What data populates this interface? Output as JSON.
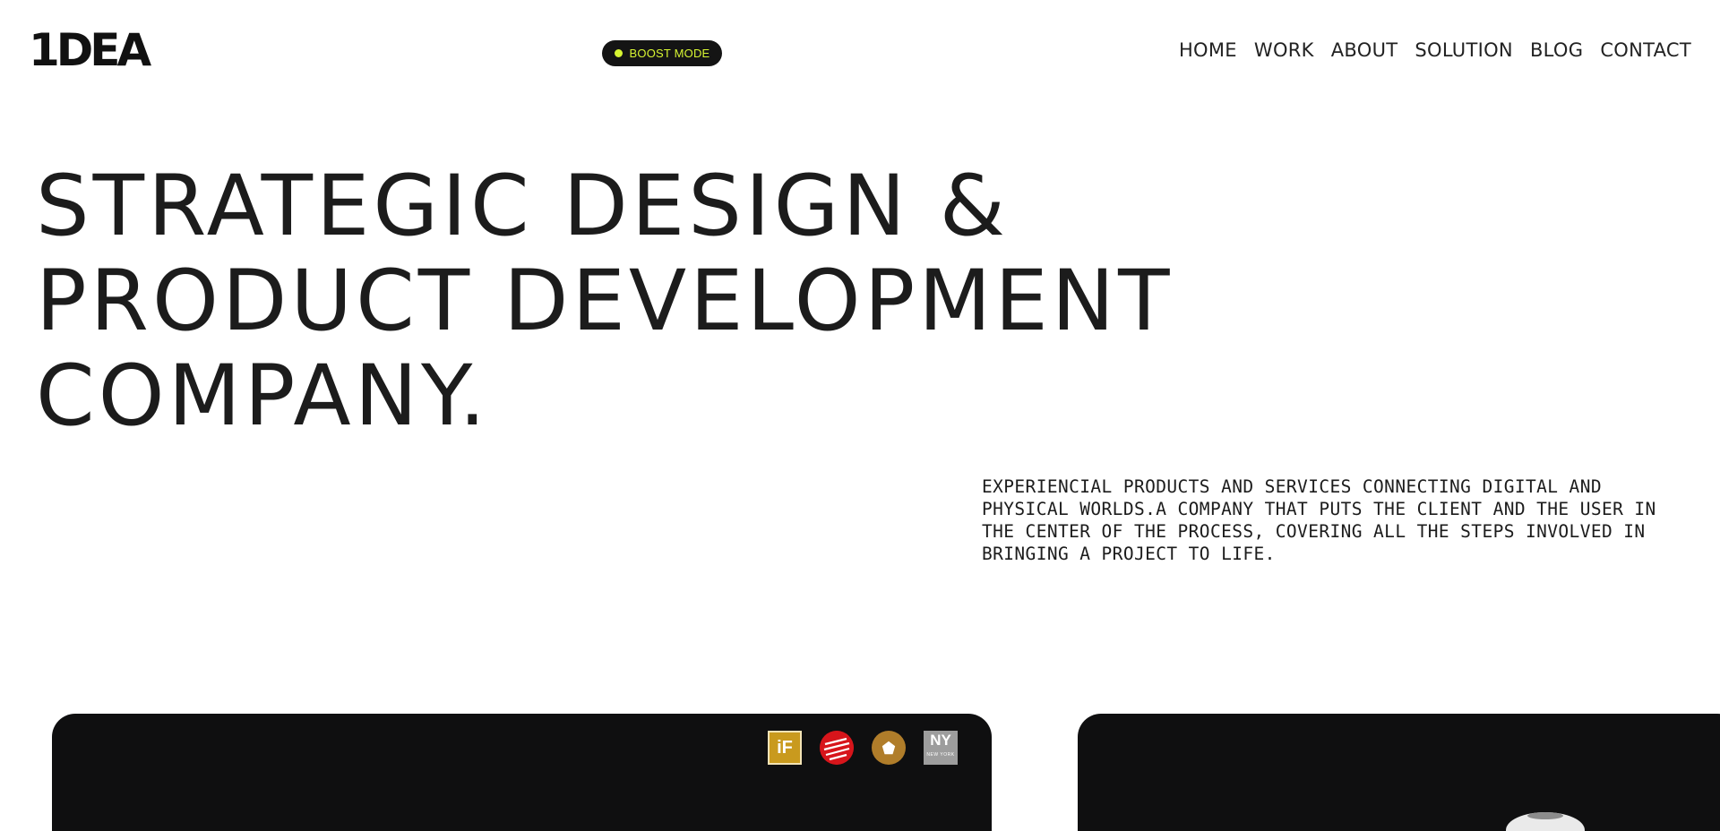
{
  "header": {
    "logo": "1DEA",
    "boost_mode_label": "BOOST MODE",
    "nav": [
      "HOME",
      "WORK",
      "ABOUT",
      "SOLUTION",
      "BLOG",
      "CONTACT"
    ]
  },
  "hero": {
    "title_lines": [
      "STRATEGIC DESIGN &",
      "PRODUCT DEVELOPMENT",
      "COMPANY."
    ],
    "description": "EXPERIENCIAL PRODUCTS AND SERVICES CONNECTING DIGITAL AND PHYSICAL WORLDS.A COMPANY THAT PUTS THE CLIENT AND THE USER IN THE CENTER OF THE PROCESS, COVERING ALL THE STEPS INVOLVED IN BRINGING A PROJECT TO LIFE."
  },
  "awards": {
    "if_label": "iF",
    "ny_label": "NY",
    "ny_sub": "NEW YORK"
  },
  "colors": {
    "accent": "#d7f532",
    "card_bg": "#0f0f10",
    "text": "#1c1c1c"
  },
  "icons": [
    "if-award-icon",
    "red-dot-award-icon",
    "gold-pentagon-award-icon",
    "ny-award-icon"
  ]
}
